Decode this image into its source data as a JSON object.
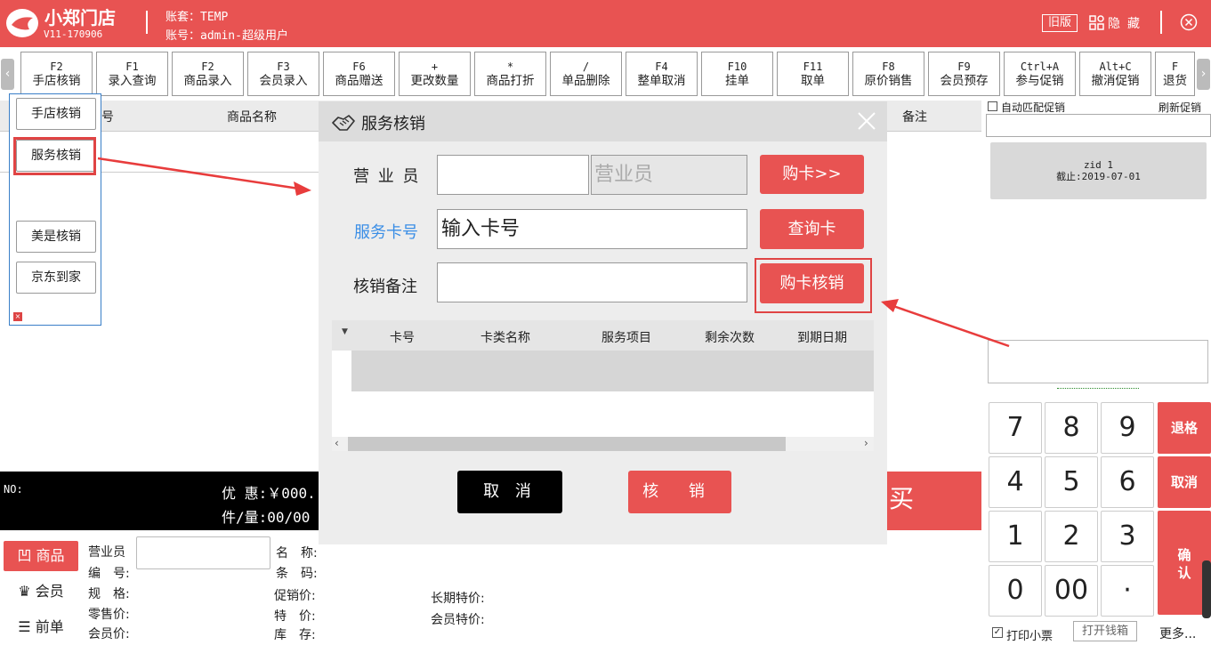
{
  "header": {
    "brand": "小郑门店",
    "version": "V11-170906",
    "account_line1": "账套：TEMP",
    "account_line2": "账号：admin-超级用户",
    "old_version": "旧版",
    "hide": "隐藏"
  },
  "colors": {
    "accent": "#e85352",
    "highlight": "#e04444"
  },
  "toolbar": [
    {
      "key": "F2",
      "label": "手店核销"
    },
    {
      "key": "F1",
      "label": "录入查询"
    },
    {
      "key": "F2",
      "label": "商品录入"
    },
    {
      "key": "F3",
      "label": "会员录入"
    },
    {
      "key": "F6",
      "label": "商品赠送"
    },
    {
      "key": "+",
      "label": "更改数量"
    },
    {
      "key": "*",
      "label": "商品打折"
    },
    {
      "key": "/",
      "label": "单品删除"
    },
    {
      "key": "F4",
      "label": "整单取消"
    },
    {
      "key": "F10",
      "label": "挂单"
    },
    {
      "key": "F11",
      "label": "取单"
    },
    {
      "key": "F8",
      "label": "原价销售"
    },
    {
      "key": "F9",
      "label": "会员预存"
    },
    {
      "key": "Ctrl+A",
      "label": "参与促销"
    },
    {
      "key": "Alt+C",
      "label": "撤消促销"
    },
    {
      "key": "F",
      "label": "退货"
    }
  ],
  "grid": {
    "col_num": "号",
    "col_name": "商品名称",
    "col_remark": "备注"
  },
  "popup_menu": {
    "items": [
      "手店核销",
      "服务核销",
      "美是核销",
      "京东到家"
    ]
  },
  "modal": {
    "title": "服务核销",
    "clerk_label": "营 业 员",
    "clerk_placeholder": "营业员",
    "buy_card": "购卡>>",
    "card_label": "服务卡号",
    "card_placeholder": "输入卡号",
    "query_card": "查询卡",
    "remark_label": "核销备注",
    "buy_verify": "购卡核销",
    "columns": [
      "卡号",
      "卡类名称",
      "服务项目",
      "剩余次数",
      "到期日期"
    ],
    "cancel": "取 消",
    "confirm": "核 销"
  },
  "summary": {
    "no_label": "NO:",
    "discount": "优 惠:￥000.",
    "pieces": "件/量:00/00",
    "pay": "买 单"
  },
  "bottom": {
    "tab_goods": "商品",
    "tab_member": "会员",
    "tab_prev": "前单",
    "clerk": "营业员",
    "code": "编　号:",
    "spec": "规　格:",
    "retail": "零售价:",
    "member_price": "会员价:",
    "name": "名　称:",
    "barcode": "条　码:",
    "promo_price": "促销价:",
    "special": "特　价:",
    "stock": "库　存:",
    "long_special": "长期特价:",
    "member_special": "会员特价:"
  },
  "right": {
    "auto_match": "自动匹配促销",
    "refresh": "刷新促销",
    "promo_id": "zid 1",
    "promo_deadline": "截止:2019-07-01"
  },
  "numpad": {
    "keys": [
      "7",
      "8",
      "9",
      "4",
      "5",
      "6",
      "1",
      "2",
      "3",
      "0",
      "00",
      "·"
    ],
    "backspace": "退格",
    "cancel": "取消",
    "confirm": "确认",
    "print": "打印小票",
    "open_drawer": "打开钱箱",
    "more": "更多..."
  }
}
